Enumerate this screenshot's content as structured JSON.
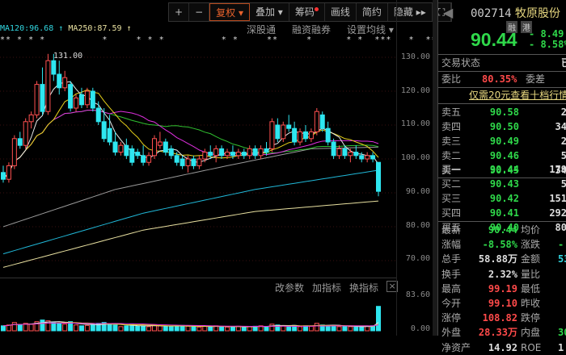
{
  "toolbar": {
    "plus": "+",
    "minus": "−",
    "fuquan": "复权 ▾",
    "diejia": "叠加 ▾",
    "chouma": "筹码",
    "huaxian": "画线",
    "jianyue": "简约",
    "yincang": "隐藏 ▸▸",
    "fullscreen": "⛶"
  },
  "legend": {
    "ma120": "MA120:96.68 ↑",
    "ma250": "MA250:87.59 ↑"
  },
  "links": {
    "sgt": "深股通",
    "rzrq": "融资融券",
    "setma": "设置均线 ▾"
  },
  "stars": "** * * *          *     * * *          * *     **     *      * *  ***   *  **",
  "high_label": "131.00",
  "y_axis": [
    "130.00",
    "120.00",
    "110.00",
    "100.00",
    "90.00",
    "80.00",
    "70.00"
  ],
  "vol_header": {
    "gcs": "改参数",
    "jzb": "加指标",
    "hzb": "换指标",
    "close": "×"
  },
  "vol_axis": [
    "83.60",
    "0.00"
  ],
  "colors": {
    "up": "#ff5050",
    "down": "#2ee6f0",
    "ma5": "#e8e8e8",
    "ma10": "#e8d21a",
    "ma20": "#e030e0",
    "ma30": "#30c030",
    "ma60": "#999999",
    "ma120": "#20b8d8",
    "ma250": "#e8e0a0"
  },
  "chart_data": {
    "type": "candlestick",
    "ylim": [
      70,
      130
    ],
    "ohlc": [
      [
        96,
        98,
        93,
        94
      ],
      [
        94,
        99,
        93,
        98
      ],
      [
        98,
        107,
        97,
        106
      ],
      [
        106,
        108,
        103,
        104
      ],
      [
        104,
        112,
        103,
        111
      ],
      [
        111,
        114,
        109,
        113
      ],
      [
        113,
        123,
        112,
        122
      ],
      [
        122,
        127,
        113,
        114
      ],
      [
        114,
        131,
        113,
        129
      ],
      [
        129,
        131,
        123,
        125
      ],
      [
        125,
        129,
        119,
        121
      ],
      [
        121,
        126,
        120,
        124
      ],
      [
        122,
        123,
        114,
        115
      ],
      [
        115,
        119,
        114,
        118
      ],
      [
        119,
        121,
        115,
        116
      ],
      [
        116,
        121,
        115,
        120
      ],
      [
        120,
        121,
        114,
        115
      ],
      [
        115,
        117,
        110,
        111
      ],
      [
        111,
        115,
        105,
        106
      ],
      [
        109,
        113,
        104,
        105
      ],
      [
        105,
        108,
        101,
        102
      ],
      [
        102,
        105,
        101,
        104
      ],
      [
        104,
        106,
        100,
        101
      ],
      [
        103,
        104,
        98,
        99
      ],
      [
        102,
        103,
        100,
        101
      ],
      [
        101,
        104,
        98,
        99
      ],
      [
        99,
        102,
        98,
        101
      ],
      [
        101,
        107,
        100,
        106
      ],
      [
        104,
        108,
        103,
        105
      ],
      [
        105,
        106,
        101,
        102
      ],
      [
        103,
        104,
        100,
        101
      ],
      [
        101,
        102,
        98,
        99
      ],
      [
        100,
        101,
        97,
        98
      ],
      [
        98,
        101,
        96,
        100
      ],
      [
        100,
        101,
        97,
        98
      ],
      [
        98,
        101,
        97,
        100
      ],
      [
        100,
        103,
        99,
        102
      ],
      [
        102,
        104,
        100,
        101
      ],
      [
        101,
        104,
        99,
        103
      ],
      [
        103,
        104,
        100,
        101
      ],
      [
        101,
        103,
        100,
        102
      ],
      [
        102,
        104,
        100,
        101
      ],
      [
        101,
        103,
        100,
        102
      ],
      [
        102,
        103,
        100,
        101
      ],
      [
        101,
        104,
        100,
        103
      ],
      [
        103,
        104,
        100,
        101
      ],
      [
        101,
        104,
        100,
        103
      ],
      [
        103,
        105,
        101,
        102
      ],
      [
        103,
        112,
        102,
        111
      ],
      [
        110,
        112,
        105,
        106
      ],
      [
        106,
        111,
        105,
        110
      ],
      [
        110,
        113,
        108,
        109
      ],
      [
        109,
        111,
        104,
        105
      ],
      [
        105,
        109,
        104,
        108
      ],
      [
        108,
        110,
        105,
        106
      ],
      [
        106,
        109,
        105,
        108
      ],
      [
        108,
        115,
        107,
        114
      ],
      [
        113,
        114,
        108,
        109
      ],
      [
        109,
        111,
        104,
        105
      ],
      [
        105,
        106,
        100,
        101
      ],
      [
        101,
        104,
        100,
        103
      ],
      [
        103,
        104,
        100,
        101
      ],
      [
        101,
        103,
        99,
        102
      ],
      [
        102,
        104,
        100,
        101
      ],
      [
        101,
        102,
        99,
        100
      ],
      [
        100,
        102,
        99,
        101
      ],
      [
        101,
        102,
        99,
        100
      ],
      [
        99,
        99,
        89,
        90.44
      ]
    ],
    "volume": [
      12,
      14,
      20,
      15,
      18,
      16,
      22,
      26,
      24,
      20,
      18,
      16,
      22,
      14,
      12,
      13,
      15,
      18,
      20,
      16,
      14,
      10,
      12,
      15,
      11,
      12,
      10,
      14,
      12,
      11,
      10,
      12,
      13,
      11,
      10,
      9,
      11,
      10,
      12,
      10,
      9,
      10,
      11,
      9,
      10,
      11,
      12,
      10,
      16,
      14,
      12,
      11,
      13,
      10,
      12,
      11,
      18,
      14,
      12,
      13,
      10,
      11,
      10,
      9,
      10,
      11,
      12,
      58.88
    ],
    "vol_ylim": [
      0,
      83.6
    ],
    "long_ma": {
      "ma60": [
        [
          0,
          80
        ],
        [
          20,
          91
        ],
        [
          40,
          98
        ],
        [
          55,
          103
        ],
        [
          67,
          103.5
        ]
      ],
      "ma120": [
        [
          0,
          72
        ],
        [
          25,
          84
        ],
        [
          45,
          91
        ],
        [
          67,
          96.68
        ]
      ],
      "ma250": [
        [
          0,
          68
        ],
        [
          25,
          79
        ],
        [
          45,
          84.5
        ],
        [
          67,
          87.59
        ]
      ]
    }
  },
  "quote": {
    "code": "002714",
    "name": "牧原股份",
    "badge1": "融",
    "badge2": "港",
    "price": "90.44",
    "change": "- 8.49",
    "pct": "- 8.58%"
  },
  "status": {
    "label": "交易状态",
    "value": "已"
  },
  "weibi": {
    "label": "委比",
    "value": "80.35%",
    "label2": "委差"
  },
  "promo": "仅需20元查看十档行情",
  "asks": [
    {
      "label": "卖五",
      "price": "90.58",
      "vol": "2"
    },
    {
      "label": "卖四",
      "price": "90.50",
      "vol": "34"
    },
    {
      "label": "卖三",
      "price": "90.49",
      "vol": "2"
    },
    {
      "label": "卖二",
      "price": "90.46",
      "vol": "5"
    },
    {
      "label": "卖一",
      "price": "90.45",
      "vol": "34"
    }
  ],
  "bids": [
    {
      "label": "买一",
      "price": "90.44",
      "vol": "179"
    },
    {
      "label": "买二",
      "price": "90.43",
      "vol": "5"
    },
    {
      "label": "买三",
      "price": "90.42",
      "vol": "151"
    },
    {
      "label": "买四",
      "price": "90.41",
      "vol": "292"
    },
    {
      "label": "买五",
      "price": "90.40",
      "vol": "80"
    }
  ],
  "stats": [
    {
      "l": "最新",
      "v": "90.44",
      "vc": "g",
      "l2": "均价",
      "v2": "",
      "c2": "w"
    },
    {
      "l": "涨幅",
      "v": "-8.58%",
      "vc": "g",
      "l2": "涨跌",
      "v2": "-",
      "c2": "g"
    },
    {
      "l": "总手",
      "v": "58.88万",
      "vc": "w",
      "l2": "金额",
      "v2": "53",
      "c2": "c"
    },
    {
      "l": "换手",
      "v": "2.32%",
      "vc": "w",
      "l2": "量比",
      "v2": "",
      "c2": "w"
    },
    {
      "l": "最高",
      "v": "99.19",
      "vc": "r",
      "l2": "最低",
      "v2": "",
      "c2": "w"
    },
    {
      "l": "今开",
      "v": "99.10",
      "vc": "r",
      "l2": "昨收",
      "v2": "",
      "c2": "w"
    },
    {
      "l": "涨停",
      "v": "108.82",
      "vc": "r",
      "l2": "跌停",
      "v2": "",
      "c2": "w"
    },
    {
      "l": "外盘",
      "v": "28.33万",
      "vc": "r",
      "l2": "内盘",
      "v2": "30",
      "c2": "g"
    },
    {
      "l": "净资产",
      "v": "14.92",
      "vc": "w",
      "l2": "ROE",
      "v2": "1",
      "c2": "w"
    }
  ]
}
